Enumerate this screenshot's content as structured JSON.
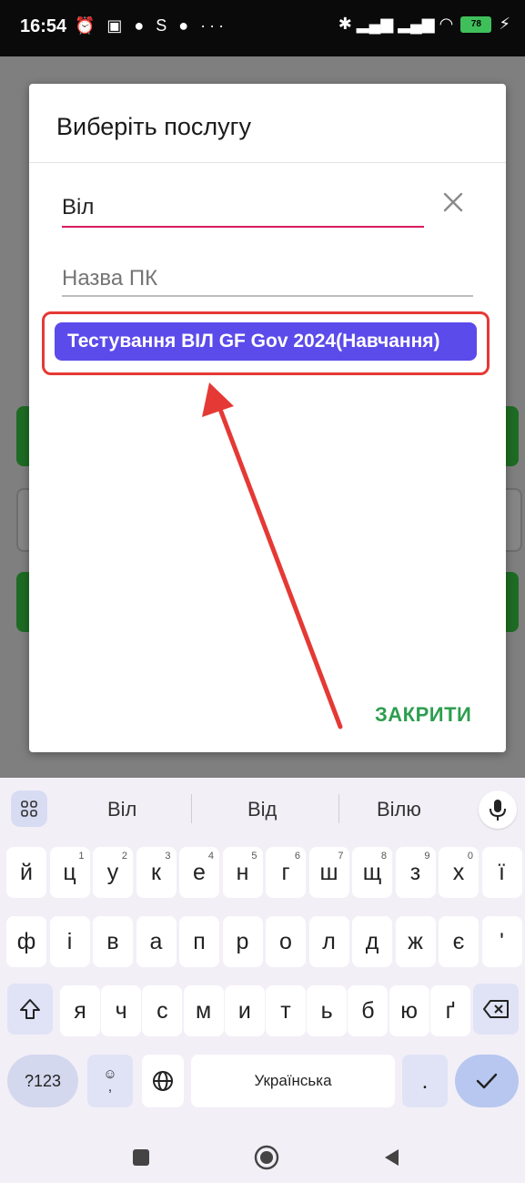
{
  "status_bar": {
    "time": "16:54",
    "left_icons": "⏰ ▣ ● S ● ···",
    "right_icons": "✱ ▂▄▆ ▂▄▆ ◠",
    "battery_level": "78"
  },
  "dialog": {
    "title": "Виберіть послугу",
    "search_value": "Віл",
    "name_placeholder": "Назва ПК",
    "result_item": "Тестування ВІЛ GF Gov 2024(Навчання)",
    "close_button": "ЗАКРИТИ",
    "accent_color": "#d81b60",
    "result_color": "#5b4bea",
    "highlight_color": "#e53935"
  },
  "keyboard": {
    "suggestions": [
      "Віл",
      "Від",
      "Вілю"
    ],
    "row1": [
      {
        "k": "й",
        "h": ""
      },
      {
        "k": "ц",
        "h": "1"
      },
      {
        "k": "у",
        "h": "2"
      },
      {
        "k": "к",
        "h": "3"
      },
      {
        "k": "е",
        "h": "4"
      },
      {
        "k": "н",
        "h": "5"
      },
      {
        "k": "г",
        "h": "6"
      },
      {
        "k": "ш",
        "h": "7"
      },
      {
        "k": "щ",
        "h": "8"
      },
      {
        "k": "з",
        "h": "9"
      },
      {
        "k": "х",
        "h": "0"
      },
      {
        "k": "ї",
        "h": ""
      }
    ],
    "row2": [
      "ф",
      "і",
      "в",
      "а",
      "п",
      "р",
      "о",
      "л",
      "д",
      "ж",
      "є",
      "'"
    ],
    "row3": [
      "я",
      "ч",
      "с",
      "м",
      "и",
      "т",
      "ь",
      "б",
      "ю",
      "ґ"
    ],
    "key_123": "?123",
    "emoji_key": "☺\n,",
    "space_label": "Українська",
    "period": "."
  }
}
